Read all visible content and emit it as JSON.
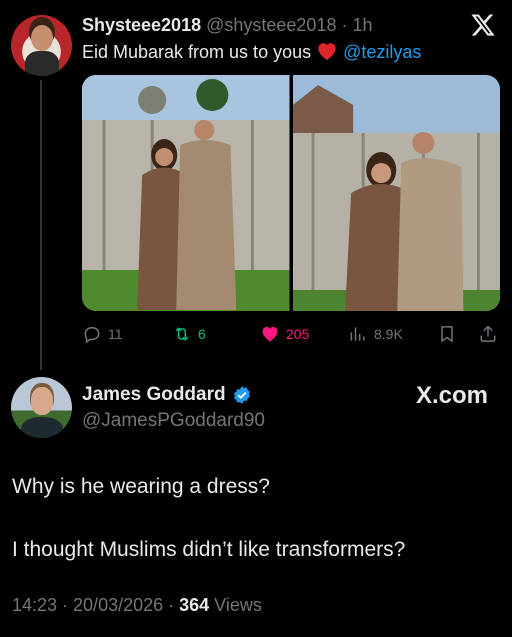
{
  "quoted_tweet": {
    "display_name": "Shysteee2018",
    "handle": "@shysteee2018",
    "separator": "·",
    "time": "1h",
    "text": "Eid Mubarak from us to yous",
    "mention": "@tezilyas",
    "actions": {
      "replies": "11",
      "reposts": "6",
      "likes": "205",
      "views": "8.9K"
    }
  },
  "main_tweet": {
    "display_name": "James Goddard",
    "handle": "@JamesPGoddard90",
    "watermark": "X.com",
    "line1": "Why is he wearing a dress?",
    "line2": "I thought Muslims didn’t like transformers?",
    "timestamp": "14:23 · 20/03/2026 · ",
    "views_count": "364",
    "views_label": " Views"
  },
  "colors": {
    "background": "#000000",
    "text": "#e7e9ea",
    "secondary": "#71767b",
    "link": "#1d9bf0",
    "like": "#f91880",
    "repost": "#00ba7c"
  },
  "icons": [
    "x-logo-icon",
    "heart-emoji-icon",
    "reply-icon",
    "repost-icon",
    "like-icon",
    "views-icon",
    "bookmark-icon",
    "share-icon",
    "verified-badge-icon"
  ]
}
